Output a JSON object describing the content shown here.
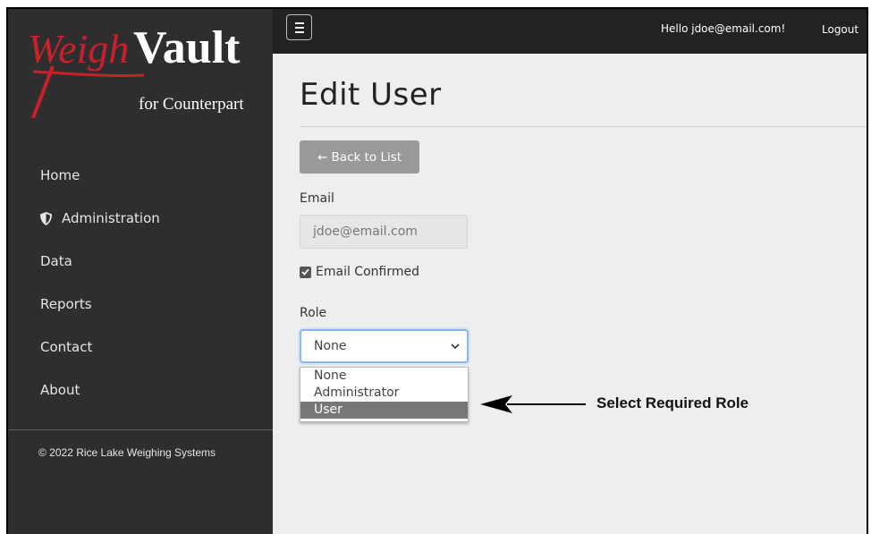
{
  "brand": {
    "logo_text_1": "Weigh",
    "logo_text_2": "Vault",
    "logo_sub": "for Counterpart",
    "colors": {
      "logo_red": "#c8202c",
      "logo_white": "#ffffff"
    }
  },
  "sidebar": {
    "items": [
      {
        "label": "Home",
        "icon": ""
      },
      {
        "label": "Administration",
        "icon": "shield-icon"
      },
      {
        "label": "Data",
        "icon": ""
      },
      {
        "label": "Reports",
        "icon": ""
      },
      {
        "label": "Contact",
        "icon": ""
      },
      {
        "label": "About",
        "icon": ""
      }
    ],
    "copyright": "© 2022 Rice Lake Weighing Systems"
  },
  "topbar": {
    "menu_icon": "hamburger-icon",
    "greeting": "Hello jdoe@email.com!",
    "logout": "Logout"
  },
  "page": {
    "title": "Edit User",
    "back_button": "← Back to List",
    "email_label": "Email",
    "email_value": "jdoe@email.com",
    "email_confirmed_label": "Email Confirmed",
    "email_confirmed": true,
    "role_label": "Role",
    "role_selected": "None",
    "role_options": [
      "None",
      "Administrator",
      "User"
    ],
    "role_highlighted": "User"
  },
  "annotation": {
    "callout": "Select Required Role"
  }
}
